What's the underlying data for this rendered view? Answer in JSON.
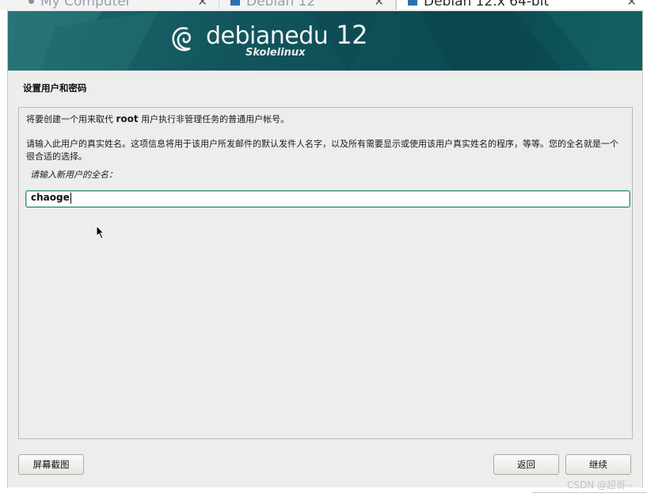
{
  "tabs": [
    {
      "label": "My Computer",
      "close": "✕"
    },
    {
      "label": "Debian 12",
      "close": "✕"
    },
    {
      "label": "Debian 12.x 64-bit",
      "close": "✕"
    }
  ],
  "banner": {
    "brand_name": "debianedu",
    "brand_version": "12",
    "brand_sub": "Skolelinux"
  },
  "page": {
    "title": "设置用户和密码",
    "para1_before": "将要创建一个用来取代 ",
    "para1_bold": "root",
    "para1_after": " 用户执行非管理任务的普通用户帐号。",
    "para2": "请输入此用户的真实姓名。这项信息将用于该用户所发邮件的默认发件人名字，以及所有需要显示或使用该用户真实姓名的程序，等等。您的全名就是一个很合适的选择。",
    "prompt": "请输入新用户的全名：",
    "fullname_value": "chaoge"
  },
  "buttons": {
    "screenshot": "屏幕截图",
    "back": "返回",
    "continue": "继续"
  },
  "watermark": "CSDN @超哥--",
  "colors": {
    "banner": "#0f4f57",
    "input_border": "#3b8a7e",
    "window_bg": "#ededeb"
  }
}
